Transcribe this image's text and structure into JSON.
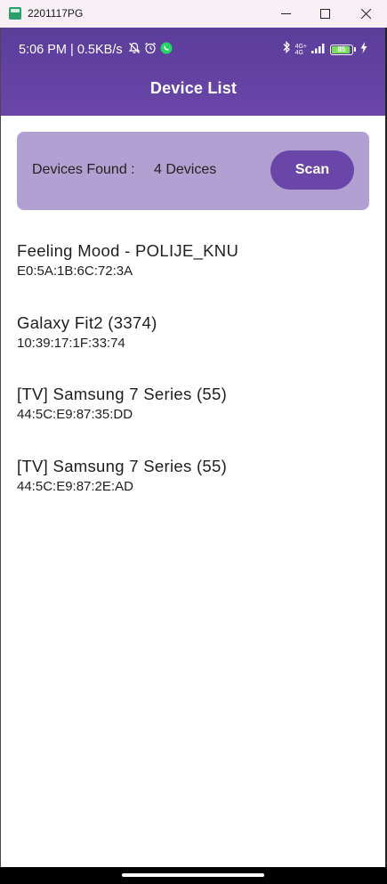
{
  "window": {
    "title": "2201117PG",
    "controls": [
      "minimize-icon",
      "maximize-icon",
      "close-icon"
    ]
  },
  "status_bar": {
    "text": "5:06 PM | 0.5KB/s",
    "icons_left": [
      "muted-bell-icon",
      "alarm-icon",
      "whatsapp-icon"
    ],
    "icons_right": [
      "bluetooth-icon",
      "signal-icon",
      "battery-icon",
      "charging-icon"
    ],
    "network_top": "4G+",
    "network_bottom": "4G",
    "battery_level": "85"
  },
  "app_bar": {
    "title": "Device List"
  },
  "found_card": {
    "label": "Devices Found :",
    "count": "4 Devices",
    "scan_label": "Scan"
  },
  "devices": [
    {
      "name": "Feeling Mood - POLIJE_KNU",
      "mac": "E0:5A:1B:6C:72:3A"
    },
    {
      "name": "Galaxy Fit2 (3374)",
      "mac": "10:39:17:1F:33:74"
    },
    {
      "name": "[TV] Samsung 7 Series (55)",
      "mac": "44:5C:E9:87:35:DD"
    },
    {
      "name": "[TV] Samsung 7 Series (55)",
      "mac": "44:5C:E9:87:2E:AD"
    }
  ],
  "colors": {
    "primary": "#6a46a9",
    "card": "#b3a0d3",
    "battery_fill": "#7adf5a",
    "whatsapp": "#25d366"
  }
}
